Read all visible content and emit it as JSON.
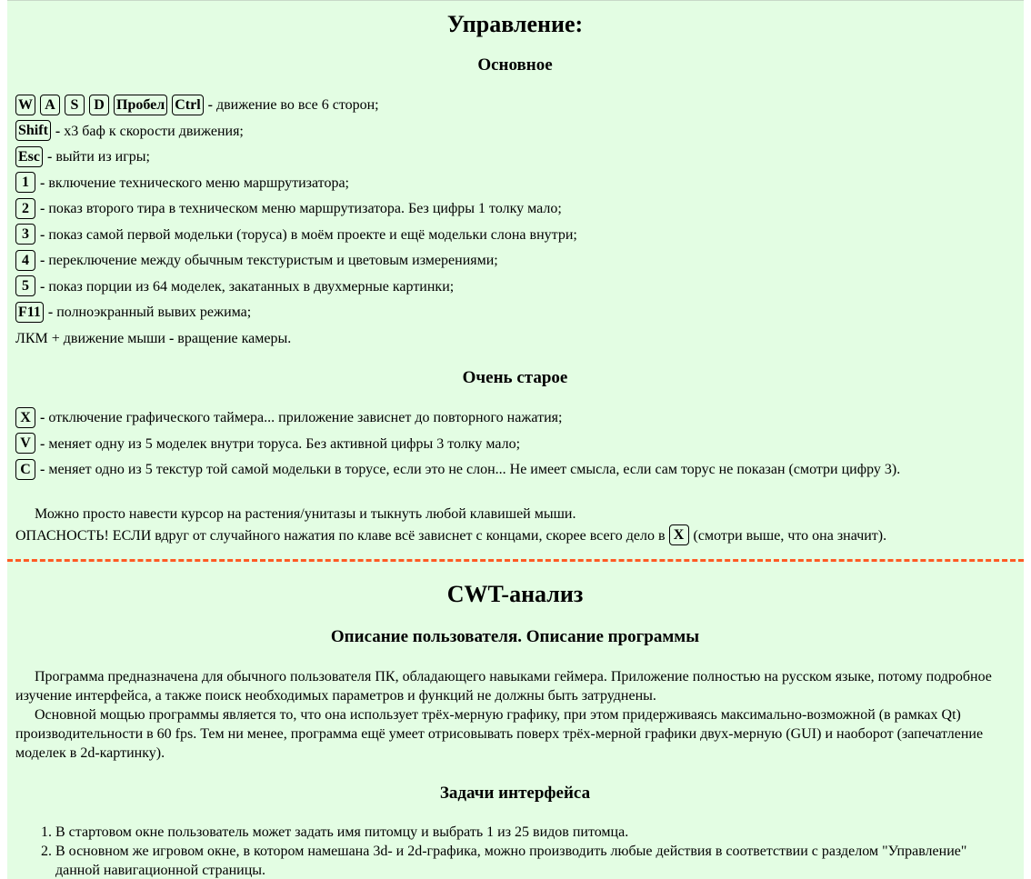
{
  "controls": {
    "title": "Управление:",
    "basic_heading": "Основное",
    "movement_keys": [
      "W",
      "A",
      "S",
      "D",
      "Пробел",
      "Ctrl"
    ],
    "sep": "-",
    "rows": [
      {
        "key": "Shift",
        "text": "x3 баф к скорости движения;"
      },
      {
        "key": "Esc",
        "text": "выйти из игры;"
      },
      {
        "key": "1",
        "text": "включение технического меню маршрутизатора;"
      },
      {
        "key": "2",
        "text": "показ второго тира в техническом меню маршрутизатора. Без цифры 1 толку мало;"
      },
      {
        "key": "3",
        "text": "показ самой первой модельки (торуса) в моём проекте и ещё модельки слона внутри;"
      },
      {
        "key": "4",
        "text": "переключение между обычным текстуристым и цветовым измерениями;"
      },
      {
        "key": "5",
        "text": "показ порции из 64 моделек, закатанных в двухмерные картинки;"
      },
      {
        "key": "F11",
        "text": "полноэкранный вывих режима;"
      }
    ],
    "movement_text": "движение во все 6 сторон;",
    "mouse_prefix": "ЛКМ + движение мыши",
    "mouse_text": "вращение камеры.",
    "old_heading": "Очень старое",
    "old_rows": [
      {
        "key": "X",
        "text": "отключение графического таймера... приложение зависнет до повторного нажатия;"
      },
      {
        "key": "V",
        "text": "меняет одну из 5 моделек внутри торуса. Без активной цифры 3 толку мало;"
      },
      {
        "key": "C",
        "text": "меняет одно из 5 текстур той самой модельки в торусе, если это не слон... Не имеет смысла, если сам торус не показан (смотри цифру 3)."
      }
    ],
    "hint": "Можно просто навести курсор на растения/унитазы и тыкнуть любой клавишей мыши.",
    "danger_prefix": "ОПАСНОСТЬ! ЕСЛИ вдруг от случайного нажатия по клаве всё зависнет с концами, скорее всего дело в",
    "danger_key": "X",
    "danger_suffix": "(смотри выше, что она значит)."
  },
  "cwt": {
    "title": "CWT-анализ",
    "user_heading": "Описание пользователя. Описание программы",
    "para1": "Программа предназначена для обычного пользователя ПК, обладающего навыками геймера. Приложение полностью на русском языке, потому подробное изучение интерфейса, а также поиск необходимых параметров и функций не должны быть затруднены.",
    "para2": "Основной мощью программы является то, что она использует трёх-мерную графику, при этом придерживаясь максимально-возможной (в рамках Qt) производительности в 60 fps. Тем ни менее, программа ещё умеет отрисовывать поверх трёх-мерной графики двух-мерную (GUI) и наоборот (запечатление моделек в 2d-картинку).",
    "tasks_heading": "Задачи интерфейса",
    "tasks": [
      "В стартовом окне пользователь может задать имя питомцу и выбрать 1 из 25 видов питомца.",
      "В основном же игровом окне, в котором намешана 3d- и 2d-графика, можно производить любые действия в соответствии с разделом \"Управление\" данной навигационной страницы."
    ]
  },
  "colors": {
    "background": "#e3fde3",
    "divider": "#ff5a24"
  }
}
